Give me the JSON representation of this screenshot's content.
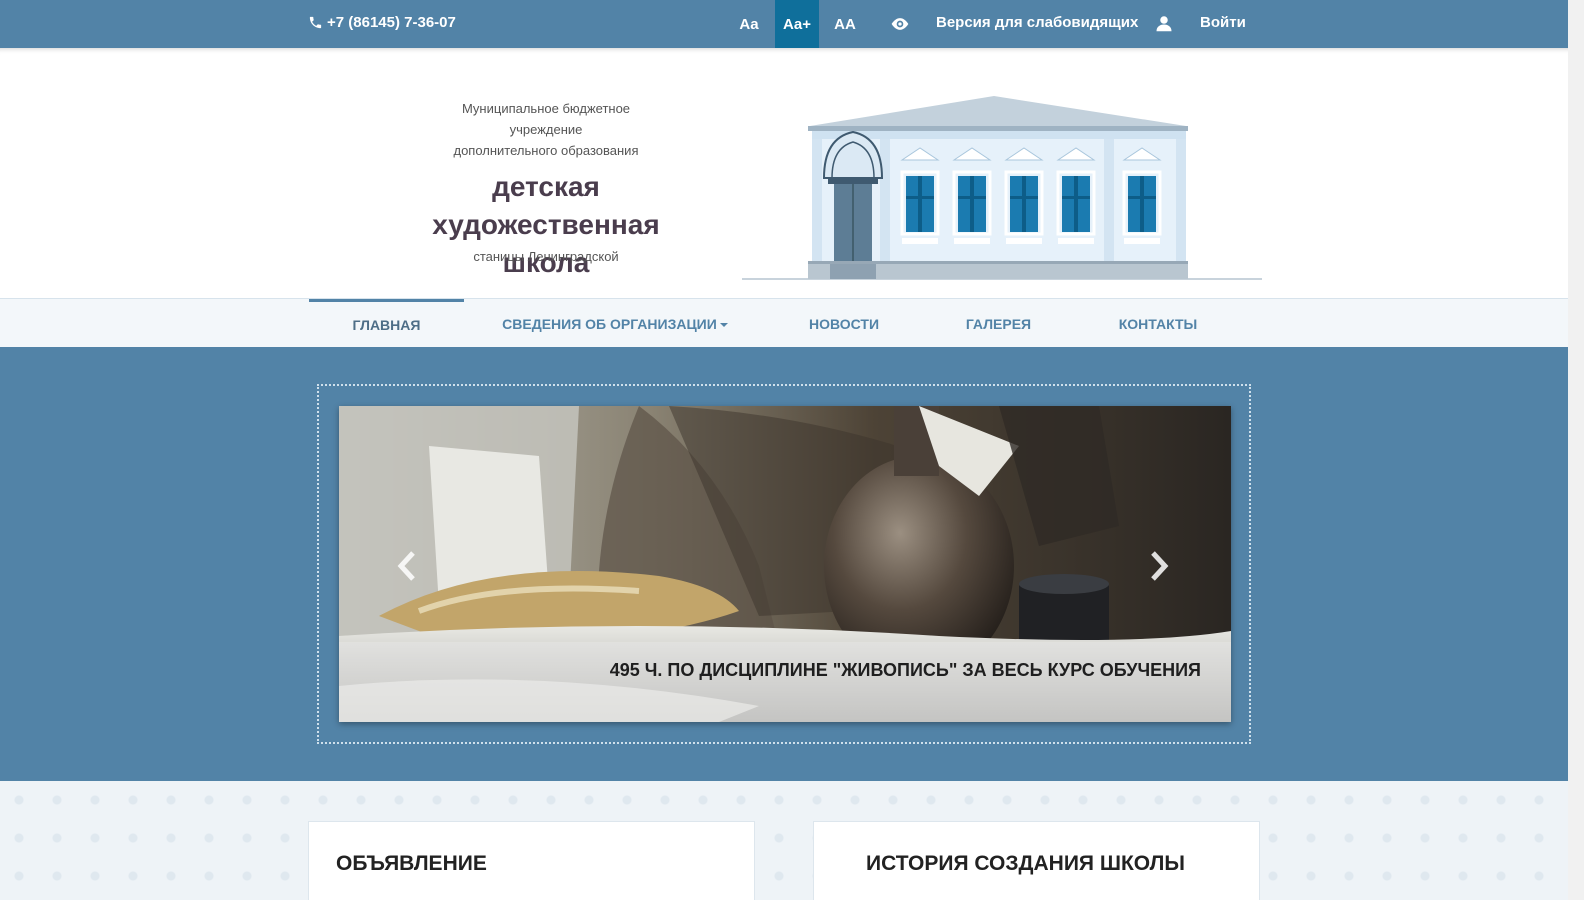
{
  "topbar": {
    "phone": "+7 (86145) 7-36-07",
    "font_small": "Aa",
    "font_medium": "Aa+",
    "font_large": "AA",
    "impaired_version": "Версия для слабовидящих",
    "login": "Войти",
    "accent": "#5283a7",
    "active_font_color": "#0f6f9b"
  },
  "brand": {
    "line1": "Муниципальное бюджетное",
    "line2": "учреждение",
    "line3": "дополнительного образования",
    "title1": "детская художественная",
    "title2": "школа",
    "town": "станицы Ленинградской"
  },
  "nav": {
    "items": [
      {
        "label": "ГЛАВНАЯ"
      },
      {
        "label": "СВЕДЕНИЯ ОБ ОРГАНИЗАЦИИ"
      },
      {
        "label": "НОВОСТИ"
      },
      {
        "label": "ГАЛЕРЕЯ"
      },
      {
        "label": "КОНТАКТЫ"
      }
    ]
  },
  "slider": {
    "caption": "495 Ч. ПО ДИСЦИПЛИНЕ \"ЖИВОПИСЬ\" ЗА ВЕСЬ КУРС ОБУЧЕНИЯ"
  },
  "cards": {
    "left_title": "ОБЪЯВЛЕНИЕ",
    "right_title": "ИСТОРИЯ СОЗДАНИЯ ШКОЛЫ"
  }
}
